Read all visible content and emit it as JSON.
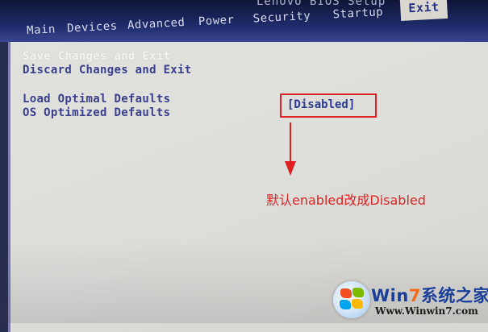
{
  "bios": {
    "title": "Lenovo BIOS Setup",
    "tabs": [
      {
        "label": "Main"
      },
      {
        "label": "Devices"
      },
      {
        "label": "Advanced"
      },
      {
        "label": "Power"
      },
      {
        "label": "Security"
      },
      {
        "label": "Startup"
      },
      {
        "label": "Exit",
        "active": true
      }
    ]
  },
  "exit_menu": {
    "items": [
      {
        "label": "Save Changes and Exit",
        "selected": true
      },
      {
        "label": "Discard Changes and Exit"
      },
      {
        "label": "Load Optimal Defaults"
      },
      {
        "label": "OS Optimized Defaults",
        "value": "[Disabled]"
      }
    ]
  },
  "annotation": {
    "text": "默认enabled改成Disabled",
    "color": "#e02525"
  },
  "watermark": {
    "brand_prefix": "Win",
    "brand_seven": "7",
    "brand_suffix": "系统之家",
    "url": "Www.Winwin7.com"
  },
  "colors": {
    "menu_bg": "#1f2a6a",
    "panel_bg": "#dededb",
    "item_text": "#3a3f8e",
    "highlight_box": "#e0202a"
  }
}
